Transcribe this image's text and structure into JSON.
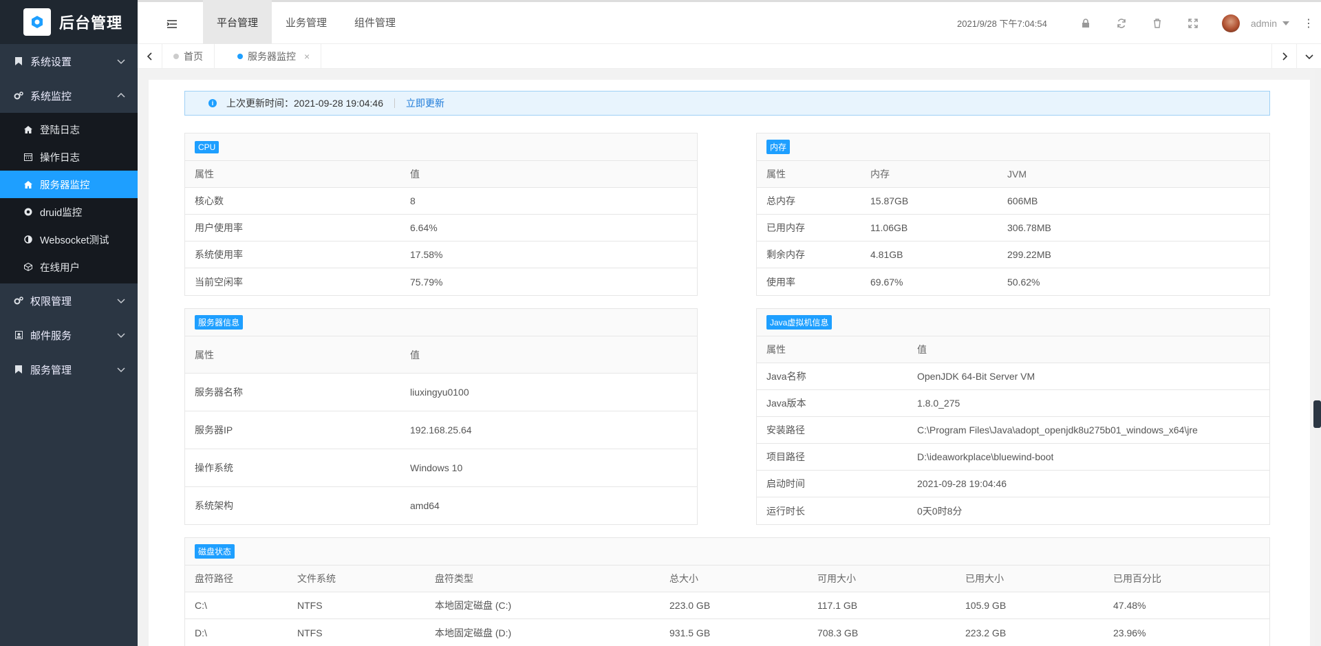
{
  "app": {
    "title": "后台管理"
  },
  "sidebar": {
    "items": [
      {
        "label": "系统设置",
        "icon": "bookmark-icon",
        "expanded": false
      },
      {
        "label": "系统监控",
        "icon": "gears-icon",
        "expanded": true,
        "children": [
          {
            "label": "登陆日志",
            "icon": "home-icon"
          },
          {
            "label": "操作日志",
            "icon": "calendar-icon"
          },
          {
            "label": "服务器监控",
            "icon": "home-icon",
            "active": true
          },
          {
            "label": "druid监控",
            "icon": "chrome-icon"
          },
          {
            "label": "Websocket测试",
            "icon": "contrast-icon"
          },
          {
            "label": "在线用户",
            "icon": "cube-icon"
          }
        ]
      },
      {
        "label": "权限管理",
        "icon": "gears-icon",
        "expanded": false
      },
      {
        "label": "邮件服务",
        "icon": "id-card-icon",
        "expanded": false
      },
      {
        "label": "服务管理",
        "icon": "bookmark-icon",
        "expanded": false
      }
    ]
  },
  "header": {
    "tabs": [
      "平台管理",
      "业务管理",
      "组件管理"
    ],
    "datetime": "2021/9/28 下午7:04:54",
    "username": "admin"
  },
  "tabbar": {
    "tabs": [
      {
        "label": "首页"
      },
      {
        "label": "服务器监控",
        "active": true
      }
    ]
  },
  "notice": {
    "label": "上次更新时间：",
    "time": "2021-09-28 19:04:46",
    "refresh": "立即更新"
  },
  "cpu": {
    "title": "CPU",
    "headers": [
      "属性",
      "值"
    ],
    "rows": [
      [
        "核心数",
        "8"
      ],
      [
        "用户使用率",
        "6.64%"
      ],
      [
        "系统使用率",
        "17.58%"
      ],
      [
        "当前空闲率",
        "75.79%"
      ]
    ]
  },
  "memory": {
    "title": "内存",
    "headers": [
      "属性",
      "内存",
      "JVM"
    ],
    "rows": [
      [
        "总内存",
        "15.87GB",
        "606MB"
      ],
      [
        "已用内存",
        "11.06GB",
        "306.78MB"
      ],
      [
        "剩余内存",
        "4.81GB",
        "299.22MB"
      ],
      [
        "使用率",
        "69.67%",
        "50.62%"
      ]
    ]
  },
  "server": {
    "title": "服务器信息",
    "headers": [
      "属性",
      "值"
    ],
    "rows": [
      [
        "服务器名称",
        "liuxingyu0100"
      ],
      [
        "服务器IP",
        "192.168.25.64"
      ],
      [
        "操作系统",
        "Windows 10"
      ],
      [
        "系统架构",
        "amd64"
      ]
    ]
  },
  "jvm": {
    "title": "Java虚拟机信息",
    "headers": [
      "属性",
      "值"
    ],
    "rows": [
      [
        "Java名称",
        "OpenJDK 64-Bit Server VM"
      ],
      [
        "Java版本",
        "1.8.0_275"
      ],
      [
        "安装路径",
        "C:\\Program Files\\Java\\adopt_openjdk8u275b01_windows_x64\\jre"
      ],
      [
        "项目路径",
        "D:\\ideaworkplace\\bluewind-boot"
      ],
      [
        "启动时间",
        "2021-09-28 19:04:46"
      ],
      [
        "运行时长",
        "0天0时8分"
      ]
    ]
  },
  "disk": {
    "title": "磁盘状态",
    "headers": [
      "盘符路径",
      "文件系统",
      "盘符类型",
      "总大小",
      "可用大小",
      "已用大小",
      "已用百分比"
    ],
    "rows": [
      [
        "C:\\",
        "NTFS",
        "本地固定磁盘 (C:)",
        "223.0 GB",
        "117.1 GB",
        "105.9 GB",
        "47.48%"
      ],
      [
        "D:\\",
        "NTFS",
        "本地固定磁盘 (D:)",
        "931.5 GB",
        "708.3 GB",
        "223.2 GB",
        "23.96%"
      ]
    ]
  },
  "colors": {
    "accent": "#1e9fff",
    "sidebar": "#2b3643",
    "sidebar_sub": "#15191f"
  }
}
